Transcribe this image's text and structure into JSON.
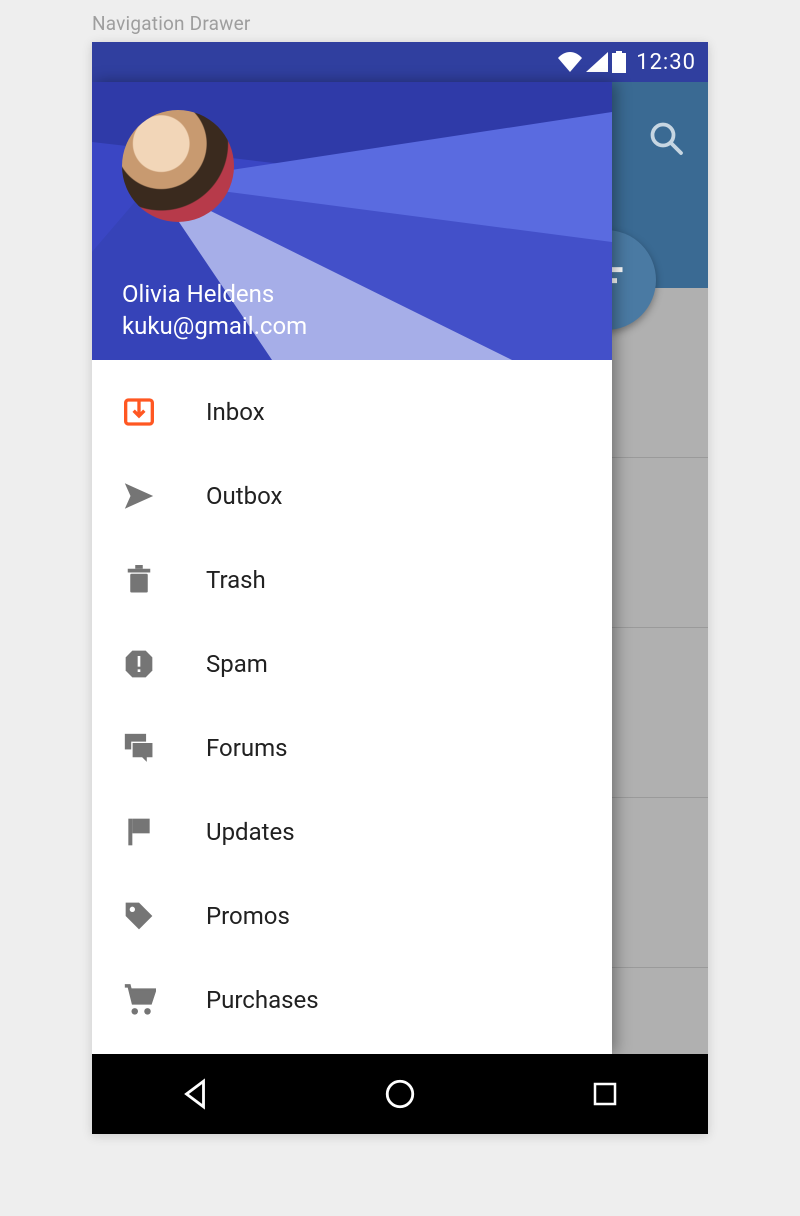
{
  "page_label": "Navigation Drawer",
  "status": {
    "time": "12:30"
  },
  "user": {
    "name": "Olivia Heldens",
    "email": "kuku@gmail.com"
  },
  "drawer": {
    "items": [
      {
        "label": "Inbox",
        "icon": "inbox"
      },
      {
        "label": "Outbox",
        "icon": "send"
      },
      {
        "label": "Trash",
        "icon": "trash"
      },
      {
        "label": "Spam",
        "icon": "spam"
      },
      {
        "label": "Forums",
        "icon": "forums"
      },
      {
        "label": "Updates",
        "icon": "flag"
      },
      {
        "label": "Promos",
        "icon": "tag"
      },
      {
        "label": "Purchases",
        "icon": "cart"
      }
    ]
  }
}
